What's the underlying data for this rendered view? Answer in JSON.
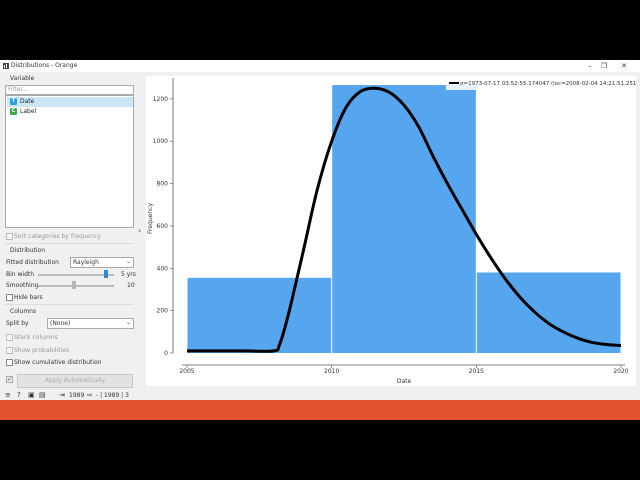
{
  "window": {
    "title": "Distributions - Orange",
    "buttons": {
      "minimize": "–",
      "restore": "❐",
      "close": "✕"
    }
  },
  "variable_section": {
    "heading": "Variable",
    "filter_placeholder": "Filter...",
    "items": [
      {
        "badge": "T",
        "badge_color": "#2aa3e0",
        "name": "Date",
        "selected": true
      },
      {
        "badge": "C",
        "badge_color": "#3aa84b",
        "name": "Label",
        "selected": false
      }
    ],
    "sort_label": "Sort categories by frequency"
  },
  "distribution_section": {
    "heading": "Distribution",
    "fitted_label": "Fitted distribution",
    "fitted_value": "Rayleigh",
    "bin_width_label": "Bin width",
    "bin_width_value": "5 yrs",
    "bin_width_level": 0.95,
    "smoothing_label": "Smoothing",
    "smoothing_value": "10",
    "smoothing_level": 0.5,
    "hide_bars_label": "Hide bars"
  },
  "columns_section": {
    "heading": "Columns",
    "split_by_label": "Split by",
    "split_by_value": "(None)",
    "stack_columns_label": "Stack columns",
    "show_probabilities_label": "Show probabilities",
    "show_cumulative_label": "Show cumulative distribution",
    "apply_label": "Apply Automatically"
  },
  "status_bar": {
    "in_count": "1989",
    "out_count": "- | 1989 | 3"
  },
  "colors": {
    "bar": "#56a6ef",
    "curve": "#000000",
    "accent_bar": "#e2542d"
  },
  "chart_data": {
    "type": "bar",
    "xlabel": "Date",
    "ylabel": "Frequency",
    "legend_text": "σ=1973-07-17 03:52:55.174047 (loc=2008-02-04 14:21:51.251050)",
    "legend_position": "top-right",
    "x_ticks": [
      "2005",
      "2010",
      "2015",
      "2020"
    ],
    "x_tick_values": [
      2005,
      2010,
      2015,
      2020
    ],
    "y_ticks": [
      0,
      200,
      400,
      600,
      800,
      1000,
      1200
    ],
    "xlim": [
      2005,
      2020
    ],
    "ylim": [
      0,
      1270
    ],
    "bins": [
      {
        "start": 2005,
        "end": 2010,
        "value": 355
      },
      {
        "start": 2010,
        "end": 2015,
        "value": 1265
      },
      {
        "start": 2015,
        "end": 2020,
        "value": 380
      }
    ],
    "fit_curve": {
      "distribution": "Rayleigh",
      "x": [
        2005,
        2006,
        2007,
        2008,
        2008.2,
        2008.5,
        2009,
        2009.5,
        2010,
        2010.5,
        2011,
        2011.5,
        2012,
        2012.5,
        2013,
        2013.5,
        2014,
        2014.5,
        2015,
        2015.5,
        2016,
        2016.5,
        2017,
        2017.5,
        2018,
        2018.5,
        2019,
        2019.5,
        2020
      ],
      "y": [
        10,
        10,
        10,
        10,
        40,
        180,
        470,
        770,
        1000,
        1160,
        1235,
        1250,
        1230,
        1170,
        1070,
        930,
        800,
        680,
        560,
        450,
        350,
        265,
        195,
        140,
        100,
        70,
        50,
        40,
        35
      ]
    }
  }
}
